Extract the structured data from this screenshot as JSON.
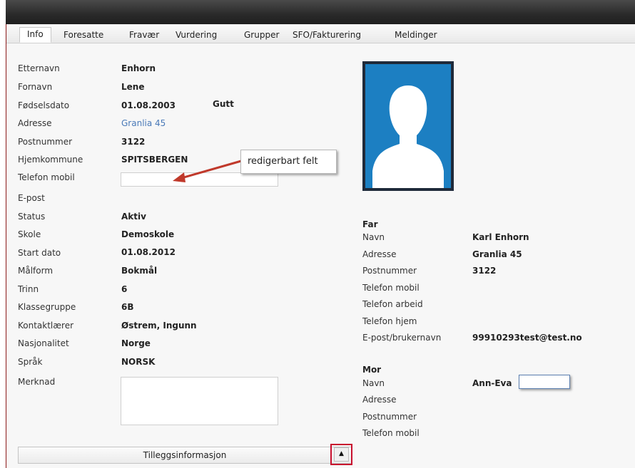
{
  "tabs": [
    "Info",
    "Foresatte",
    "Fravær",
    "Vurdering",
    "Grupper",
    "SFO/Fakturering",
    "Meldinger"
  ],
  "student": {
    "etternavn_label": "Etternavn",
    "etternavn": "Enhorn",
    "fornavn_label": "Fornavn",
    "fornavn": "Lene",
    "fodselsdato_label": "Fødselsdato",
    "fodselsdato": "01.08.2003",
    "kjonn": "Gutt",
    "adresse_label": "Adresse",
    "adresse": "Granlia 45",
    "postnummer_label": "Postnummer",
    "postnummer": "3122",
    "hjemkommune_label": "Hjemkommune",
    "hjemkommune": "SPITSBERGEN",
    "telefon_mobil_label": "Telefon mobil",
    "telefon_mobil": "",
    "epost_label": "E-post",
    "status_label": "Status",
    "status": "Aktiv",
    "skole_label": "Skole",
    "skole": "Demoskole",
    "startdato_label": "Start dato",
    "startdato": "01.08.2012",
    "malform_label": "Målform",
    "malform": "Bokmål",
    "trinn_label": "Trinn",
    "trinn": "6",
    "klassegruppe_label": "Klassegruppe",
    "klassegruppe": "6B",
    "kontaktlaerer_label": "Kontaktlærer",
    "kontaktlaerer": "Østrem, Ingunn",
    "nasjonalitet_label": "Nasjonalitet",
    "nasjonalitet": "Norge",
    "sprak_label": "Språk",
    "sprak": "NORSK",
    "merknad_label": "Merknad",
    "merknad": ""
  },
  "callout": {
    "text": "redigerbart felt"
  },
  "far": {
    "title": "Far",
    "navn_label": "Navn",
    "navn": "Karl Enhorn",
    "adresse_label": "Adresse",
    "adresse": "Granlia 45",
    "postnummer_label": "Postnummer",
    "postnummer": "3122",
    "telefon_mobil_label": "Telefon mobil",
    "telefon_arbeid_label": "Telefon arbeid",
    "telefon_hjem_label": "Telefon hjem",
    "epost_label": "E-post/brukernavn",
    "epost": "99910293test@test.no"
  },
  "mor": {
    "title": "Mor",
    "navn_label": "Navn",
    "navn": "Ann-Eva",
    "adresse_label": "Adresse",
    "postnummer_label": "Postnummer",
    "telefon_mobil_label": "Telefon mobil"
  },
  "bottom": {
    "label": "Tilleggsinformasjon",
    "toggle_icon": "▲"
  },
  "colors": {
    "accent": "#c8102e",
    "link": "#4a7ab8",
    "photo_bg": "#1c7fc2"
  }
}
